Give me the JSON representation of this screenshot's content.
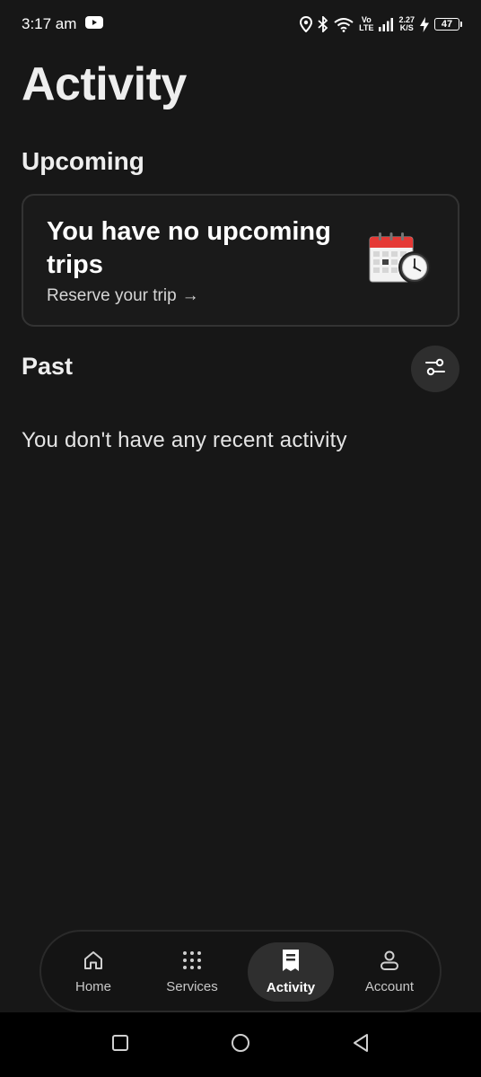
{
  "status_bar": {
    "time": "3:17 am",
    "network_top": "Vo",
    "network_bottom": "LTE",
    "speed_top": "2.27",
    "speed_bottom": "K/S",
    "battery": "47",
    "icons": [
      "youtube-icon",
      "location-icon",
      "bluetooth-icon",
      "wifi-icon",
      "signal-icon",
      "charging-icon",
      "battery-icon"
    ]
  },
  "page": {
    "title": "Activity"
  },
  "upcoming": {
    "heading": "Upcoming",
    "card_title": "You have no upcoming trips",
    "link_label": "Reserve your trip",
    "arrow": "→"
  },
  "past": {
    "heading": "Past",
    "empty_message": "You don't have any recent activity"
  },
  "bottom_nav": {
    "items": [
      {
        "label": "Home",
        "icon": "home-icon",
        "active": false
      },
      {
        "label": "Services",
        "icon": "grid-icon",
        "active": false
      },
      {
        "label": "Activity",
        "icon": "receipt-icon",
        "active": true
      },
      {
        "label": "Account",
        "icon": "person-icon",
        "active": false
      }
    ]
  },
  "colors": {
    "background": "#171717",
    "card_border": "#333333",
    "active_nav_bg": "#2f2f2f",
    "calendar_red": "#e53935"
  }
}
